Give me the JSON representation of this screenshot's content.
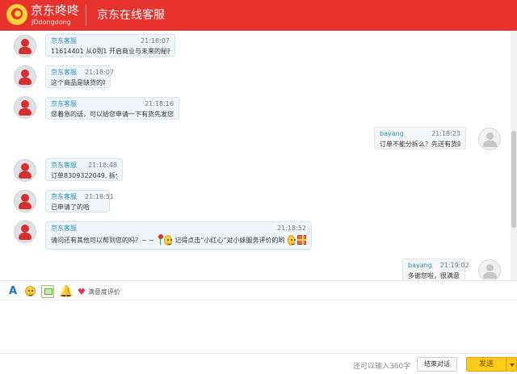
{
  "header": {
    "logo_text": "京东咚咚",
    "logo_sub": "JDdongdong",
    "title": "京东在线客服"
  },
  "messages": [
    {
      "sender": "京东客服",
      "time": "21:18:07",
      "text": "11614401 从0到1 开启商业与未来的秘密 [简"
    },
    {
      "sender": "京东客服",
      "time": "21:18:07",
      "text": "这个商品是缺货的呢"
    },
    {
      "sender": "京东客服",
      "time": "21:18:16",
      "text": "您着急的话，可以给您申请一下有货先发您的哦"
    },
    {
      "sender": "bayang",
      "time": "21:18:23",
      "text": "订单不能分拆么？先送有货的？"
    },
    {
      "sender": "京东客服",
      "time": "21:18:48",
      "text": "订单8309322049, 拆分成功"
    },
    {
      "sender": "京东客服",
      "time": "21:18:51",
      "text": "已申请了的哈"
    },
    {
      "sender": "京东客服",
      "time": "21:18:52",
      "text_part1": "请问还有其他可以帮到您的吗？~ ~",
      "text_part2": "记得点击“小红心”对小妹服务评价的哟"
    },
    {
      "sender": "bayang",
      "time": "21:19:02",
      "text": "多谢您啦，很满意。"
    }
  ],
  "toolbar": {
    "font_icon": "A",
    "rating_label": "满意度评价"
  },
  "footer": {
    "counter": "还可以输入360字",
    "end_label": "结束对话",
    "send_label": "发送"
  },
  "colors": {
    "brand_red": "#e8322e",
    "send_yellow": "#ffcc1b"
  }
}
